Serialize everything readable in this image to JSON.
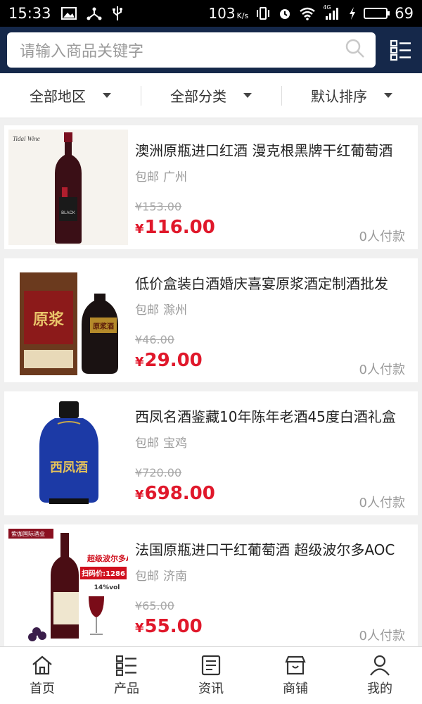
{
  "status_bar": {
    "time": "15:33",
    "speed": "103",
    "speed_unit": "K/s",
    "network": "4G",
    "battery": "69",
    "battery_level": 0.69
  },
  "header": {
    "search_placeholder": "请输入商品关键字"
  },
  "filters": [
    {
      "label": "全部地区"
    },
    {
      "label": "全部分类"
    },
    {
      "label": "默认排序"
    }
  ],
  "products": [
    {
      "title": "澳洲原瓶进口红酒 漫克根黑牌干红葡萄酒",
      "shipping": "包邮",
      "city": "广州",
      "orig_price": "¥153.00",
      "currency": "¥",
      "price": "116.00",
      "paid": "0人付款"
    },
    {
      "title": "低价盒装白酒婚庆喜宴原浆酒定制酒批发",
      "shipping": "包邮",
      "city": "滁州",
      "orig_price": "¥46.00",
      "currency": "¥",
      "price": "29.00",
      "paid": "0人付款"
    },
    {
      "title": "西凤名酒鉴藏10年陈年老酒45度白酒礼盒",
      "shipping": "包邮",
      "city": "宝鸡",
      "orig_price": "¥720.00",
      "currency": "¥",
      "price": "698.00",
      "paid": "0人付款"
    },
    {
      "title": "法国原瓶进口干红葡萄酒 超级波尔多AOC",
      "shipping": "包邮",
      "city": "济南",
      "orig_price": "¥65.00",
      "currency": "¥",
      "price": "55.00",
      "paid": "0人付款"
    }
  ],
  "tabs": [
    {
      "label": "首页",
      "icon": "home-icon"
    },
    {
      "label": "产品",
      "icon": "product-list-icon"
    },
    {
      "label": "资讯",
      "icon": "news-icon"
    },
    {
      "label": "商铺",
      "icon": "store-icon"
    },
    {
      "label": "我的",
      "icon": "user-icon"
    }
  ],
  "thumb_text": {
    "p1_brand": "Tidal Wine",
    "p1_label": "BLACK",
    "p2_box": "原浆",
    "p2_bottle": "原浆酒",
    "p3_bottle": "西凤酒",
    "p4_banner": "超级波尔多AOC",
    "p4_price": "扫码价:1286",
    "p4_abv": "14%vol",
    "p4_brand": "紫伽国际酒业"
  },
  "colors": {
    "header_bg": "#15284a",
    "price_red": "#e0182b",
    "statusbar_bg": "#000000"
  }
}
